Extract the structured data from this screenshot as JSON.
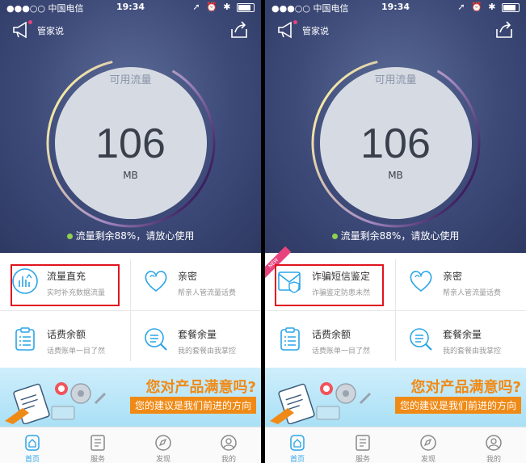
{
  "panels": [
    {
      "status": {
        "carrier": "●●●○○ 中国电信",
        "time": "19:34"
      },
      "header": {
        "label": "管家说"
      },
      "gauge": {
        "label": "可用流量",
        "value": "106",
        "unit": "MB",
        "remain_text": "流量剩余88%，请放心使用",
        "fill_fraction": 0.88
      },
      "menu": [
        {
          "title": "流量直充",
          "subtitle": "实时补充数据流量",
          "icon": "traffic-recharge-icon"
        },
        {
          "title": "亲密",
          "subtitle": "帮亲人管流量话费",
          "icon": "heart-icon"
        },
        {
          "title": "话费余额",
          "subtitle": "话费账单一目了然",
          "icon": "bill-list-icon"
        },
        {
          "title": "套餐余量",
          "subtitle": "我的套餐由我掌控",
          "icon": "plan-search-icon"
        }
      ],
      "highlight_index": 0,
      "banner": {
        "title": "您对产品满意吗?",
        "subtitle": "您的建议是我们前进的方向"
      },
      "tabs": [
        {
          "label": "首页",
          "icon": "home-icon",
          "active": true
        },
        {
          "label": "服务",
          "icon": "service-icon",
          "active": false
        },
        {
          "label": "发现",
          "icon": "discover-icon",
          "active": false
        },
        {
          "label": "我的",
          "icon": "profile-icon",
          "active": false
        }
      ]
    },
    {
      "status": {
        "carrier": "●●●○○ 中国电信",
        "time": "19:34"
      },
      "header": {
        "label": "管家说"
      },
      "gauge": {
        "label": "可用流量",
        "value": "106",
        "unit": "MB",
        "remain_text": "流量剩余88%，请放心使用",
        "fill_fraction": 0.88
      },
      "corner_badge": "NEW",
      "menu": [
        {
          "title": "诈骗短信鉴定",
          "subtitle": "诈骗鉴定防患未然",
          "icon": "sms-shield-icon"
        },
        {
          "title": "亲密",
          "subtitle": "帮亲人管流量话费",
          "icon": "heart-icon"
        },
        {
          "title": "话费余额",
          "subtitle": "话费账单一目了然",
          "icon": "bill-list-icon"
        },
        {
          "title": "套餐余量",
          "subtitle": "我的套餐由我掌控",
          "icon": "plan-search-icon"
        }
      ],
      "highlight_index": 0,
      "banner": {
        "title": "您对产品满意吗?",
        "subtitle": "您的建议是我们前进的方向"
      },
      "tabs": [
        {
          "label": "首页",
          "icon": "home-icon",
          "active": true
        },
        {
          "label": "服务",
          "icon": "service-icon",
          "active": false
        },
        {
          "label": "发现",
          "icon": "discover-icon",
          "active": false
        },
        {
          "label": "我的",
          "icon": "profile-icon",
          "active": false
        }
      ]
    }
  ],
  "colors": {
    "accent": "#2aa5e8",
    "highlight": "#e0141e",
    "banner_orange": "#f08a16",
    "hero": "#3d4a78"
  }
}
